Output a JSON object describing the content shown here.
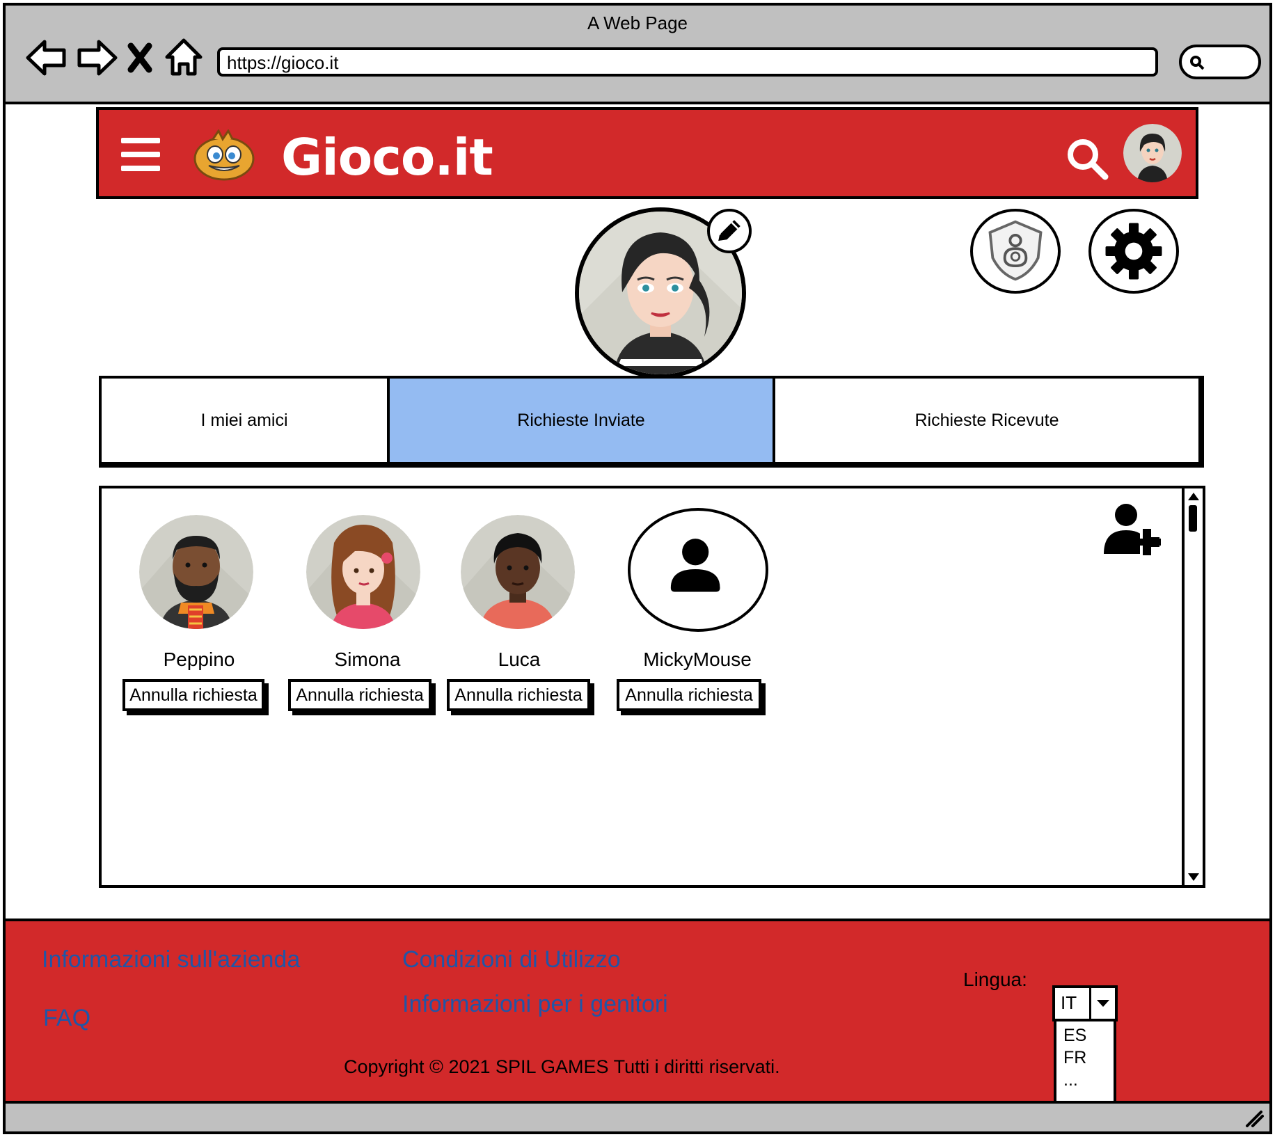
{
  "window": {
    "title": "A Web Page",
    "url": "https://gioco.it"
  },
  "header": {
    "brand": "Gioco.it",
    "brand_color": "#d2292a"
  },
  "tabs": [
    {
      "label": "I miei amici",
      "active": false
    },
    {
      "label": "Richieste Inviate",
      "active": true
    },
    {
      "label": "Richieste Ricevute",
      "active": false
    }
  ],
  "active_tab_color": "#94bbf2",
  "friends": [
    {
      "name": "Peppino",
      "action": "Annulla richiesta"
    },
    {
      "name": "Simona",
      "action": "Annulla richiesta"
    },
    {
      "name": "Luca",
      "action": "Annulla richiesta"
    },
    {
      "name": "MickyMouse",
      "action": "Annulla richiesta"
    }
  ],
  "footer": {
    "links": {
      "company_info": "Informazioni sull'azienda",
      "terms": "Condizioni di Utilizzo",
      "faq": "FAQ",
      "parents_info": "Informazioni per i genitori"
    },
    "copyright": "Copyright © 2021 SPIL GAMES Tutti i diritti riservati.",
    "language_label": "Lingua:",
    "language_selected": "IT",
    "language_options": [
      "ES",
      "FR",
      "..."
    ],
    "link_color": "#1f56a8"
  },
  "icons": [
    "back-arrow-icon",
    "forward-arrow-icon",
    "close-icon",
    "home-icon",
    "search-icon",
    "menu-icon",
    "mascot-logo-icon",
    "pencil-icon",
    "parental-shield-icon",
    "gear-icon",
    "add-user-icon",
    "user-icon",
    "chevron-down-icon",
    "resize-grip-icon"
  ]
}
